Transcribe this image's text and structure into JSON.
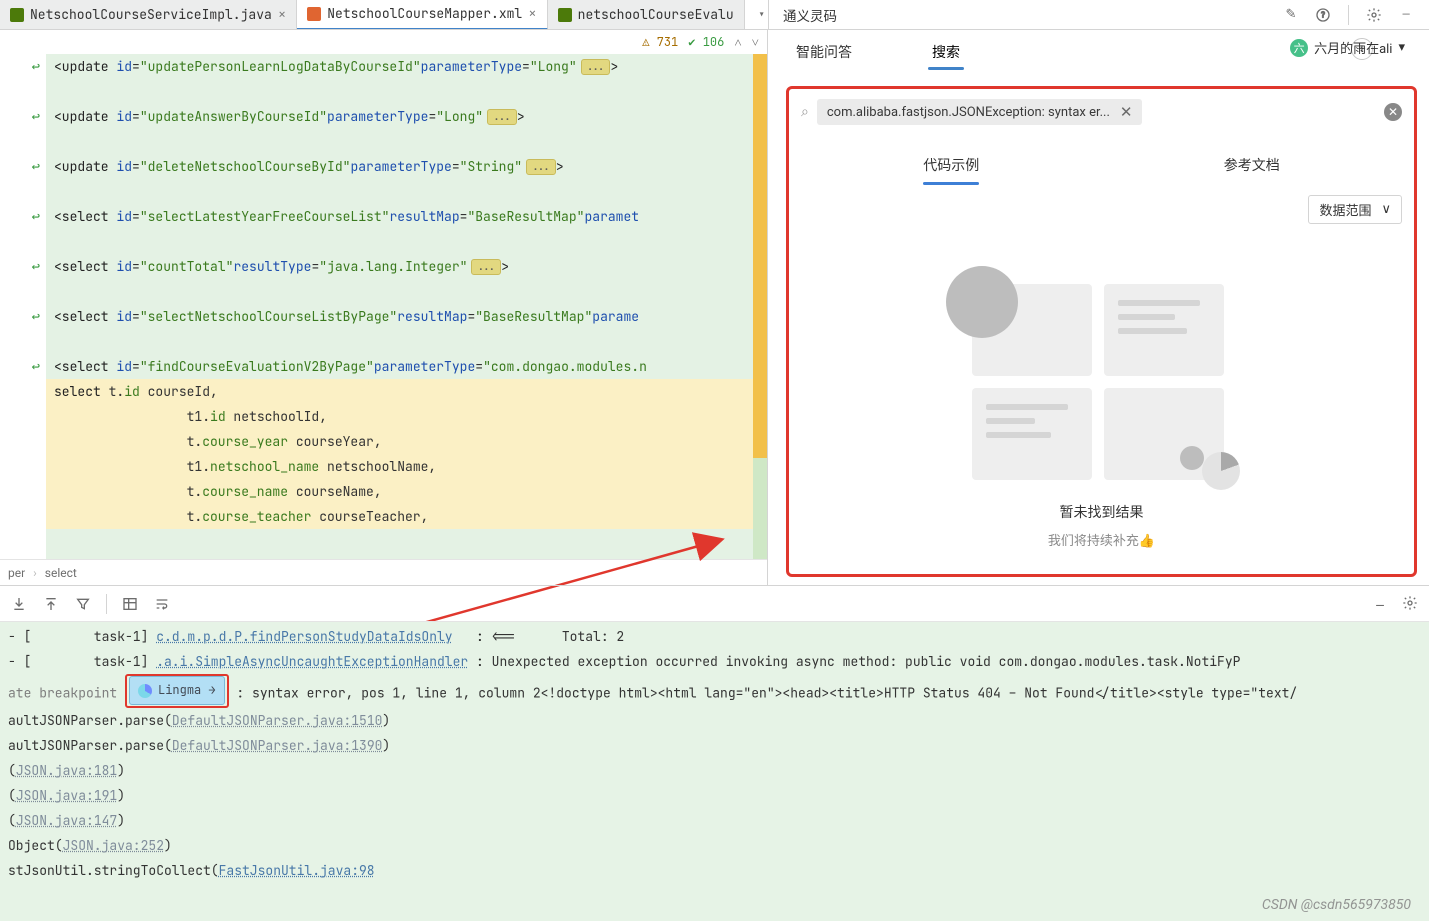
{
  "tabs": [
    {
      "label": "NetschoolCourseServiceImpl.java",
      "active": false
    },
    {
      "label": "NetschoolCourseMapper.xml",
      "active": true
    },
    {
      "label": "netschoolCourseEvalu",
      "active": false
    }
  ],
  "tab_chevron": "▾",
  "tab_kebab": "⋮",
  "lingma": {
    "title": "通义灵码",
    "edit_icon": "✎",
    "help_icon": "?",
    "settings_icon": "⚙",
    "tabs": {
      "qa": "智能问答",
      "search": "搜索"
    },
    "username": "六月的雨在ali",
    "avatar_char": "六",
    "plus": "+",
    "inner_tabs": {
      "code": "代码示例",
      "docs": "参考文档"
    },
    "search_token": "com.alibaba.fastjson.JSONException: syntax er...",
    "scope_label": "数据范围",
    "empty_title": "暂未找到结果",
    "empty_sub": "我们将持续补充👍",
    "search_placeholder": ""
  },
  "inspection": {
    "warn_count": "731",
    "ok_count": "106"
  },
  "breadcrumb": {
    "a": "per",
    "b": "select",
    "sep": "›"
  },
  "code_lines": [
    {
      "g": "↩",
      "sel": false,
      "html": "<span class='tag'>&lt;update </span><span class='attrn'>id</span>=<span class='attrv'>\"updatePersonLearnLogDataByCourseId\"</span> <span class='attrn'>parameterType</span>=<span class='attrv'>\"Long\"</span><button class='foldbtn'>...</button><span class='tag'>&gt;</span>"
    },
    {
      "g": "",
      "sel": false,
      "html": ""
    },
    {
      "g": "↩",
      "sel": false,
      "html": "<span class='tag'>&lt;update </span><span class='attrn'>id</span>=<span class='attrv'>\"updateAnswerByCourseId\"</span> <span class='attrn'>parameterType</span>=<span class='attrv'>\"Long\"</span><button class='foldbtn'>...</button><span class='tag'>&gt;</span>"
    },
    {
      "g": "",
      "sel": false,
      "html": ""
    },
    {
      "g": "↩",
      "sel": false,
      "html": "<span class='tag'>&lt;update </span><span class='attrn'>id</span>=<span class='attrv'>\"deleteNetschoolCourseById\"</span> <span class='attrn'>parameterType</span>=<span class='attrv'>\"String\"</span><button class='foldbtn'>...</button><span class='tag'>&gt;</span>"
    },
    {
      "g": "",
      "sel": false,
      "html": ""
    },
    {
      "g": "↩",
      "sel": false,
      "html": "<span class='tag'>&lt;select </span><span class='attrn'>id</span>=<span class='attrv'>\"selectLatestYearFreeCourseList\"</span> <span class='attrn'>resultMap</span>=<span class='attrv'>\"BaseResultMap\"</span> <span class='attrn'>paramet</span>"
    },
    {
      "g": "",
      "sel": false,
      "html": ""
    },
    {
      "g": "↩",
      "sel": false,
      "html": "<span class='tag'>&lt;select </span><span class='attrn'>id</span>=<span class='attrv'>\"countTotal\"</span> <span class='attrn'>resultType</span>=<span class='attrv'>\"java.lang.Integer\"</span><button class='foldbtn'>...</button><span class='tag'>&gt;</span>"
    },
    {
      "g": "",
      "sel": false,
      "html": ""
    },
    {
      "g": "↩",
      "sel": false,
      "html": "<span class='tag'>&lt;select </span><span class='attrn'>id</span>=<span class='attrv'>\"selectNetschoolCourseListByPage\"</span> <span class='attrn'>resultMap</span>=<span class='attrv'>\"BaseResultMap\"</span> <span class='attrn'>parame</span>"
    },
    {
      "g": "",
      "sel": false,
      "html": ""
    },
    {
      "g": "↩",
      "sel": false,
      "html": "<span class='tag'>&lt;select </span><span class='attrn'>id</span>=<span class='attrv'>\"findCourseEvaluationV2ByPage\"</span> <span class='attrn'>parameterType</span>=<span class='attrv'>\"com.dongao.modules.n</span>"
    },
    {
      "g": "",
      "sel": true,
      "html": "    <span class='kw'>select</span> t.<span class='fld'>id</span> courseId,"
    },
    {
      "g": "",
      "sel": true,
      "html": "           t1.<span class='fld'>id</span> netschoolId,"
    },
    {
      "g": "",
      "sel": true,
      "html": "           t.<span class='fld'>course_year</span> courseYear,"
    },
    {
      "g": "",
      "sel": true,
      "html": "           t1.<span class='fld'>netschool_name</span> netschoolName,"
    },
    {
      "g": "",
      "sel": true,
      "html": "           t.<span class='fld'>course_name</span> courseName,"
    },
    {
      "g": "",
      "sel": true,
      "html": "           t.<span class='fld'>course_teacher</span> courseTeacher,"
    }
  ],
  "console": {
    "rows": [
      "- [        task-1] <span class='clink'>c.d.m.p.d.P.findPersonStudyDataIdsOnly</span>   <span class='csym'>:</span> &lt;==      Total: 2",
      "- [        task-1] <span class='clink'>.a.i.SimpleAsyncUncaughtExceptionHandler</span> <span class='csym'>:</span> Unexpected exception occurred invoking async method: public void com.dongao.modules.task.NotiFyP",
      ""
    ],
    "breakpoint_prefix": "ate breakpoint ",
    "lingma_pill": "Lingma →",
    "err_tail": " : syntax error, pos 1, line 1, column 2&lt;!doctype html&gt;&lt;html lang=\"en\"&gt;&lt;head&gt;&lt;title&gt;HTTP Status 404 – Not Found&lt;/title&gt;&lt;style type=\"text/",
    "stack": [
      "aultJSONParser.parse(<span class='clink g'>DefaultJSONParser.java:1510</span>)",
      "aultJSONParser.parse(<span class='clink g'>DefaultJSONParser.java:1390</span>)",
      "(<span class='clink g'>JSON.java:181</span>)",
      "(<span class='clink g'>JSON.java:191</span>)",
      "(<span class='clink g'>JSON.java:147</span>)",
      "Object(<span class='clink g'>JSON.java:252</span>)",
      "stJsonUtil.stringToCollect(<span class='clink'>FastJsonUtil.java:98</span>"
    ]
  },
  "watermark": "CSDN @csdn565973850"
}
